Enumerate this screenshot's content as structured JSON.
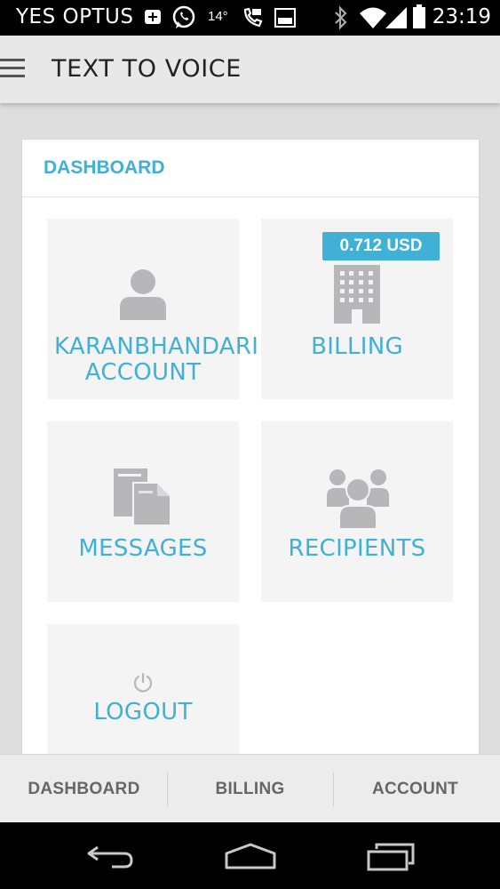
{
  "status_bar": {
    "carrier": "YES OPTUS",
    "temperature": "14°",
    "time": "23:19",
    "icons": [
      "plus-icon",
      "whatsapp-icon",
      "temperature",
      "voip-icon",
      "image-icon",
      "bluetooth-icon",
      "wifi-icon",
      "signal-icon",
      "battery-icon"
    ]
  },
  "app_bar": {
    "title": "TEXT TO VOICE"
  },
  "dashboard": {
    "title": "DASHBOARD",
    "tiles": [
      {
        "label_line1": "KARANBHANDARI",
        "label_line2": "ACCOUNT",
        "icon": "user-icon"
      },
      {
        "label": "BILLING",
        "icon": "building-icon",
        "badge": "0.712 USD"
      },
      {
        "label": "MESSAGES",
        "icon": "documents-icon"
      },
      {
        "label": "RECIPIENTS",
        "icon": "group-icon"
      },
      {
        "label": "LOGOUT",
        "icon": "power-icon"
      }
    ]
  },
  "bottom_nav": {
    "items": [
      {
        "label": "DASHBOARD"
      },
      {
        "label": "BILLING"
      },
      {
        "label": "ACCOUNT"
      }
    ]
  },
  "colors": {
    "accent": "#41b0d6",
    "tile_bg": "#f4f4f5",
    "icon_gray": "#b7b7b9",
    "status_bar": "#000000"
  }
}
